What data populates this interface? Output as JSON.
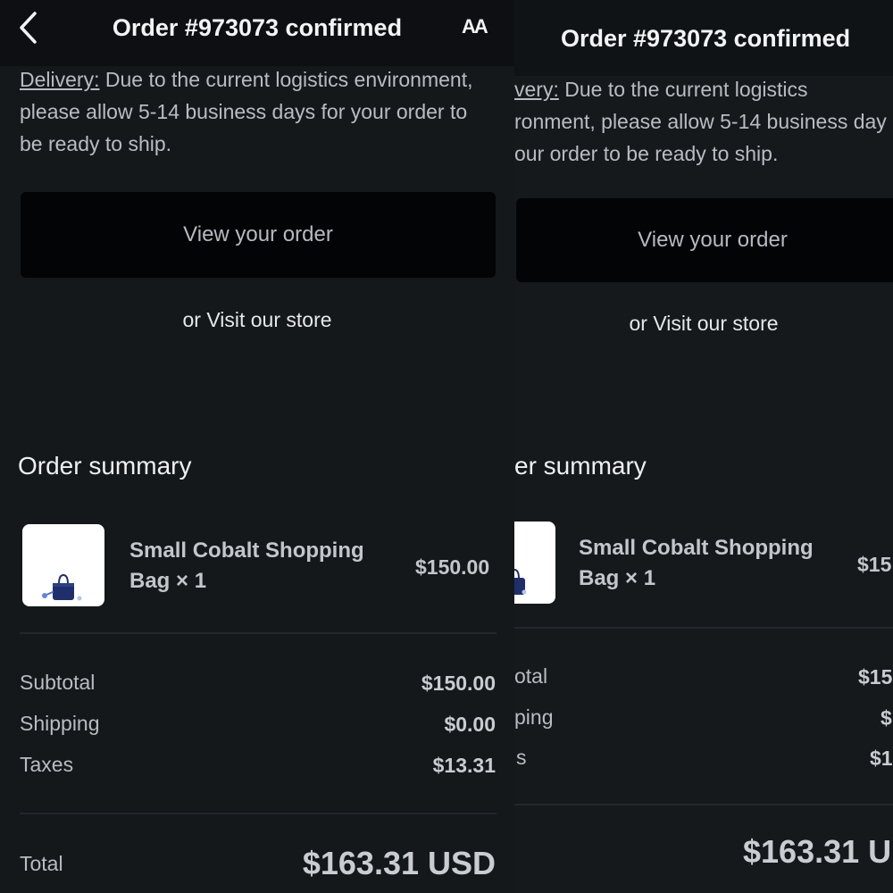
{
  "header": {
    "title": "Order #973073 confirmed",
    "text_size_label": "AA"
  },
  "delivery": {
    "label": "Delivery:",
    "message": " Due to the current logistics environment, please allow 5-14 business days for your order to be ready to ship.",
    "right_line1_label": "very:",
    "right_line1_text": " Due to the current logistics",
    "right_line2": "ronment, please allow 5-14 business day",
    "right_line3": "our order to be ready to ship."
  },
  "actions": {
    "view_order": "View your order",
    "visit_store": "or Visit our store"
  },
  "summary": {
    "heading": "Order summary",
    "heading_right": "er summary",
    "item": {
      "name_line1": "Small Cobalt Shopping",
      "name_line2": "Bag × 1",
      "price": "$150.00",
      "price_right": "$15"
    },
    "rows": [
      {
        "label": "Subtotal",
        "value": "$150.00",
        "label_right": "otal",
        "value_right": "$15"
      },
      {
        "label": "Shipping",
        "value": "$0.00",
        "label_right": "ping",
        "value_right": "$"
      },
      {
        "label": "Taxes",
        "value": "$13.31",
        "label_right": "s",
        "value_right": "$1"
      }
    ],
    "total_label": "Total",
    "total_value": "$163.31 USD",
    "total_value_right": "$163.31 U"
  },
  "icons": {
    "back": "chevron-left-icon",
    "text_size": "text-size-icon",
    "product": "handbag-image"
  },
  "colors": {
    "background": "#15181b",
    "header": "#0d0f12",
    "button": "#030405",
    "product_blue": "#1f2f6b"
  }
}
